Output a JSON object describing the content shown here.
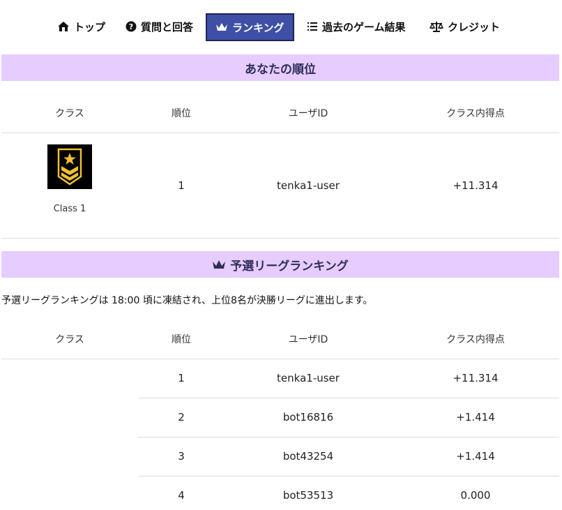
{
  "nav": {
    "items": [
      {
        "label": "トップ",
        "icon": "home-icon"
      },
      {
        "label": "質問と回答",
        "icon": "question-icon"
      },
      {
        "label": "ランキング",
        "icon": "crown-icon",
        "active": true
      },
      {
        "label": "過去のゲーム結果",
        "icon": "list-icon"
      },
      {
        "label": "クレジット",
        "icon": "scale-icon"
      }
    ]
  },
  "your_rank": {
    "title": "あなたの順位",
    "headers": {
      "class": "クラス",
      "rank": "順位",
      "user_id": "ユーザID",
      "score": "クラス内得点"
    },
    "row": {
      "class_label": "Class 1",
      "rank": "1",
      "user_id": "tenka1-user",
      "score": "+11.314"
    }
  },
  "qualifier": {
    "title": "予選リーグランキング",
    "notice": "予選リーグランキングは 18:00 頃に凍結され、上位8名が決勝リーグに進出します。",
    "headers": {
      "class": "クラス",
      "rank": "順位",
      "user_id": "ユーザID",
      "score": "クラス内得点"
    },
    "rows": [
      {
        "rank": "1",
        "user_id": "tenka1-user",
        "score": "+11.314"
      },
      {
        "rank": "2",
        "user_id": "bot16816",
        "score": "+1.414"
      },
      {
        "rank": "3",
        "user_id": "bot43254",
        "score": "+1.414"
      },
      {
        "rank": "4",
        "user_id": "bot53513",
        "score": "0.000"
      }
    ]
  },
  "colors": {
    "section_bg": "#e6ccff",
    "active_tab": "#3f4fa6",
    "badge_gold": "#f2c12e"
  }
}
